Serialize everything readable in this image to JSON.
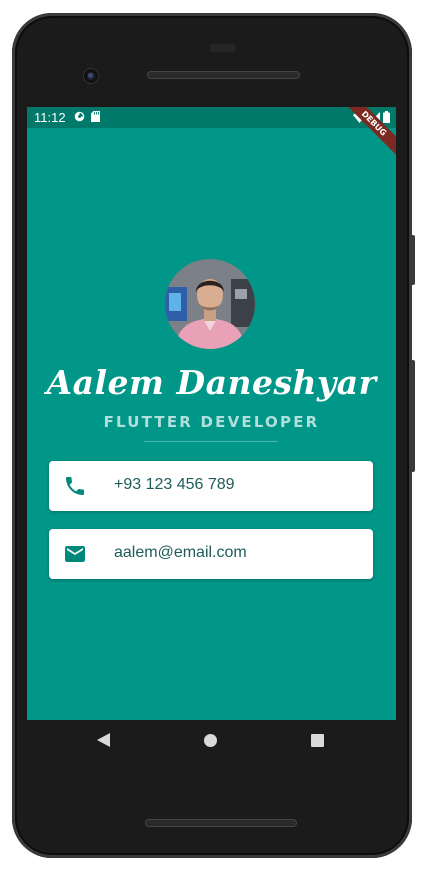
{
  "status_bar": {
    "time": "11:12",
    "left_icons": [
      "data-saver-icon",
      "sd-card-icon"
    ],
    "right_icons": [
      "wifi-icon",
      "cell-signal-icon",
      "battery-icon"
    ],
    "debug_banner": "DEBUG"
  },
  "profile": {
    "name": "Aalem Daneshyar",
    "title": "FLUTTER DEVELOPER",
    "avatar_icon": "profile-photo"
  },
  "contacts": [
    {
      "icon": "phone-icon",
      "text": "+93 123 456 789"
    },
    {
      "icon": "email-icon",
      "text": "aalem@email.com"
    }
  ],
  "nav_bar": {
    "icons": [
      "back-icon",
      "home-icon",
      "recents-icon"
    ]
  },
  "colors": {
    "background": "#009688",
    "status_bar": "#00796b",
    "accent_text": "#b2dfdb",
    "card_text": "#1e5c5a",
    "icon": "#00897b"
  }
}
